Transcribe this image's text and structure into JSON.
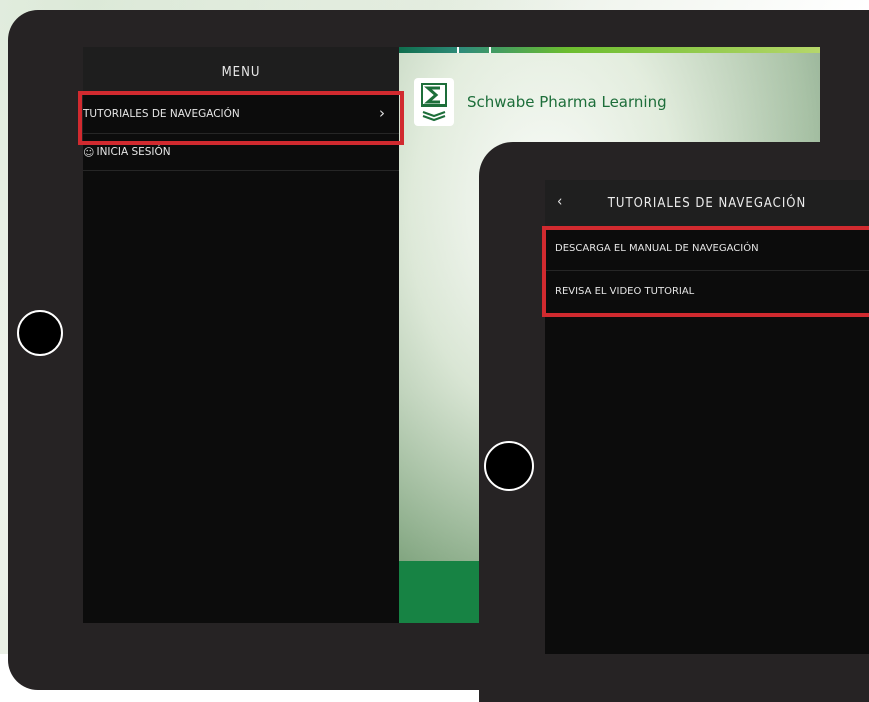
{
  "menu": {
    "header": "MENU",
    "items": [
      {
        "label": "TUTORIALES DE NAVEGACIÓN",
        "chevron": "chevron-right-icon"
      },
      {
        "label": "INICIA SESIÓN",
        "icon": "user-icon"
      }
    ]
  },
  "app": {
    "brand": "Schwabe Pharma Learning",
    "logo_icon": "schwabe-logo"
  },
  "tutorials": {
    "title": "TUTORIALES DE NAVEGACIÓN",
    "back_icon": "chevron-left-icon",
    "items": [
      {
        "label": "DESCARGA EL MANUAL DE NAVEGACIÓN"
      },
      {
        "label": "REVISA EL VIDEO TUTORIAL"
      }
    ]
  },
  "colors": {
    "highlight": "#d12a2f",
    "brand_green": "#1d6e3a",
    "band_green": "#178344",
    "tablet_frame": "#262324"
  }
}
